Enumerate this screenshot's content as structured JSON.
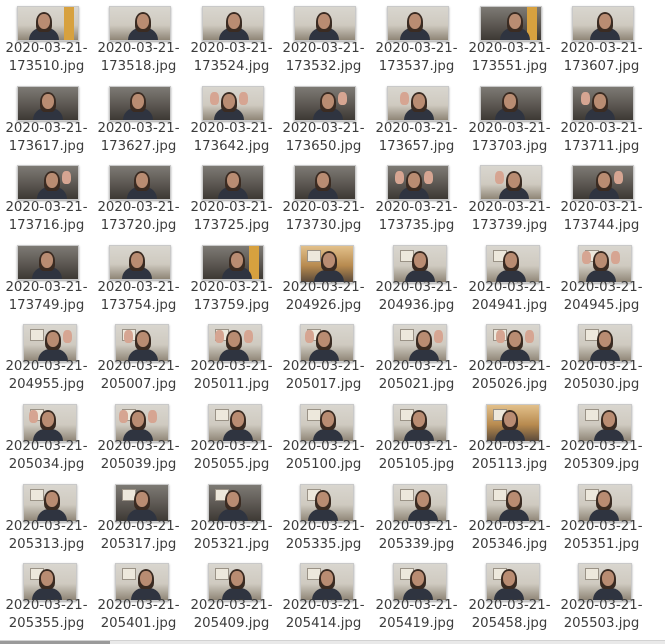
{
  "files": [
    [
      "2020-03-21-",
      "173510.jpg"
    ],
    [
      "2020-03-21-",
      "173518.jpg"
    ],
    [
      "2020-03-21-",
      "173524.jpg"
    ],
    [
      "2020-03-21-",
      "173532.jpg"
    ],
    [
      "2020-03-21-",
      "173537.jpg"
    ],
    [
      "2020-03-21-",
      "173551.jpg"
    ],
    [
      "2020-03-21-",
      "173607.jpg"
    ],
    [
      "2020-03-21-",
      "173617.jpg"
    ],
    [
      "2020-03-21-",
      "173627.jpg"
    ],
    [
      "2020-03-21-",
      "173642.jpg"
    ],
    [
      "2020-03-21-",
      "173650.jpg"
    ],
    [
      "2020-03-21-",
      "173657.jpg"
    ],
    [
      "2020-03-21-",
      "173703.jpg"
    ],
    [
      "2020-03-21-",
      "173711.jpg"
    ],
    [
      "2020-03-21-",
      "173716.jpg"
    ],
    [
      "2020-03-21-",
      "173720.jpg"
    ],
    [
      "2020-03-21-",
      "173725.jpg"
    ],
    [
      "2020-03-21-",
      "173730.jpg"
    ],
    [
      "2020-03-21-",
      "173735.jpg"
    ],
    [
      "2020-03-21-",
      "173739.jpg"
    ],
    [
      "2020-03-21-",
      "173744.jpg"
    ],
    [
      "2020-03-21-",
      "173749.jpg"
    ],
    [
      "2020-03-21-",
      "173754.jpg"
    ],
    [
      "2020-03-21-",
      "173759.jpg"
    ],
    [
      "2020-03-21-",
      "204926.jpg"
    ],
    [
      "2020-03-21-",
      "204936.jpg"
    ],
    [
      "2020-03-21-",
      "204941.jpg"
    ],
    [
      "2020-03-21-",
      "204945.jpg"
    ],
    [
      "2020-03-21-",
      "204955.jpg"
    ],
    [
      "2020-03-21-",
      "205007.jpg"
    ],
    [
      "2020-03-21-",
      "205011.jpg"
    ],
    [
      "2020-03-21-",
      "205017.jpg"
    ],
    [
      "2020-03-21-",
      "205021.jpg"
    ],
    [
      "2020-03-21-",
      "205026.jpg"
    ],
    [
      "2020-03-21-",
      "205030.jpg"
    ],
    [
      "2020-03-21-",
      "205034.jpg"
    ],
    [
      "2020-03-21-",
      "205039.jpg"
    ],
    [
      "2020-03-21-",
      "205055.jpg"
    ],
    [
      "2020-03-21-",
      "205100.jpg"
    ],
    [
      "2020-03-21-",
      "205105.jpg"
    ],
    [
      "2020-03-21-",
      "205113.jpg"
    ],
    [
      "2020-03-21-",
      "205309.jpg"
    ],
    [
      "2020-03-21-",
      "205313.jpg"
    ],
    [
      "2020-03-21-",
      "205317.jpg"
    ],
    [
      "2020-03-21-",
      "205321.jpg"
    ],
    [
      "2020-03-21-",
      "205335.jpg"
    ],
    [
      "2020-03-21-",
      "205339.jpg"
    ],
    [
      "2020-03-21-",
      "205346.jpg"
    ],
    [
      "2020-03-21-",
      "205351.jpg"
    ],
    [
      "2020-03-21-",
      "205355.jpg"
    ],
    [
      "2020-03-21-",
      "205401.jpg"
    ],
    [
      "2020-03-21-",
      "205409.jpg"
    ],
    [
      "2020-03-21-",
      "205414.jpg"
    ],
    [
      "2020-03-21-",
      "205419.jpg"
    ],
    [
      "2020-03-21-",
      "205458.jpg"
    ],
    [
      "2020-03-21-",
      "205503.jpg"
    ]
  ],
  "thumb_style": [
    "light-door",
    "light",
    "light",
    "light",
    "light",
    "dark-door",
    "light",
    "dark",
    "dark",
    "light-hand",
    "dark-hand",
    "light-hand",
    "dark",
    "dark-hand",
    "dark-hand",
    "dark",
    "dark",
    "dark",
    "dark-hand",
    "light-hand",
    "dark-hand",
    "dark",
    "light",
    "dark-door",
    "warm-portrait",
    "light-portrait",
    "light-portrait",
    "light-portrait-hand",
    "light-portrait-hand",
    "light-portrait-hand",
    "light-portrait-hand",
    "light-portrait-hand",
    "light-portrait-hand",
    "light-portrait-hand",
    "light-portrait",
    "light-portrait-hand",
    "light-portrait-hand",
    "light-portrait",
    "light-portrait",
    "light-portrait",
    "warm-portrait",
    "light-portrait",
    "light-portrait",
    "dark-portrait",
    "dark-portrait",
    "light-portrait",
    "light-portrait",
    "light-portrait",
    "light-portrait",
    "light-portrait",
    "light-portrait",
    "light-portrait",
    "light-portrait",
    "light-portrait",
    "light-portrait",
    "light-portrait"
  ],
  "colors": {
    "text": "#3c3c3c",
    "background": "#ffffff",
    "thumb_border": "#c9c9c9"
  }
}
